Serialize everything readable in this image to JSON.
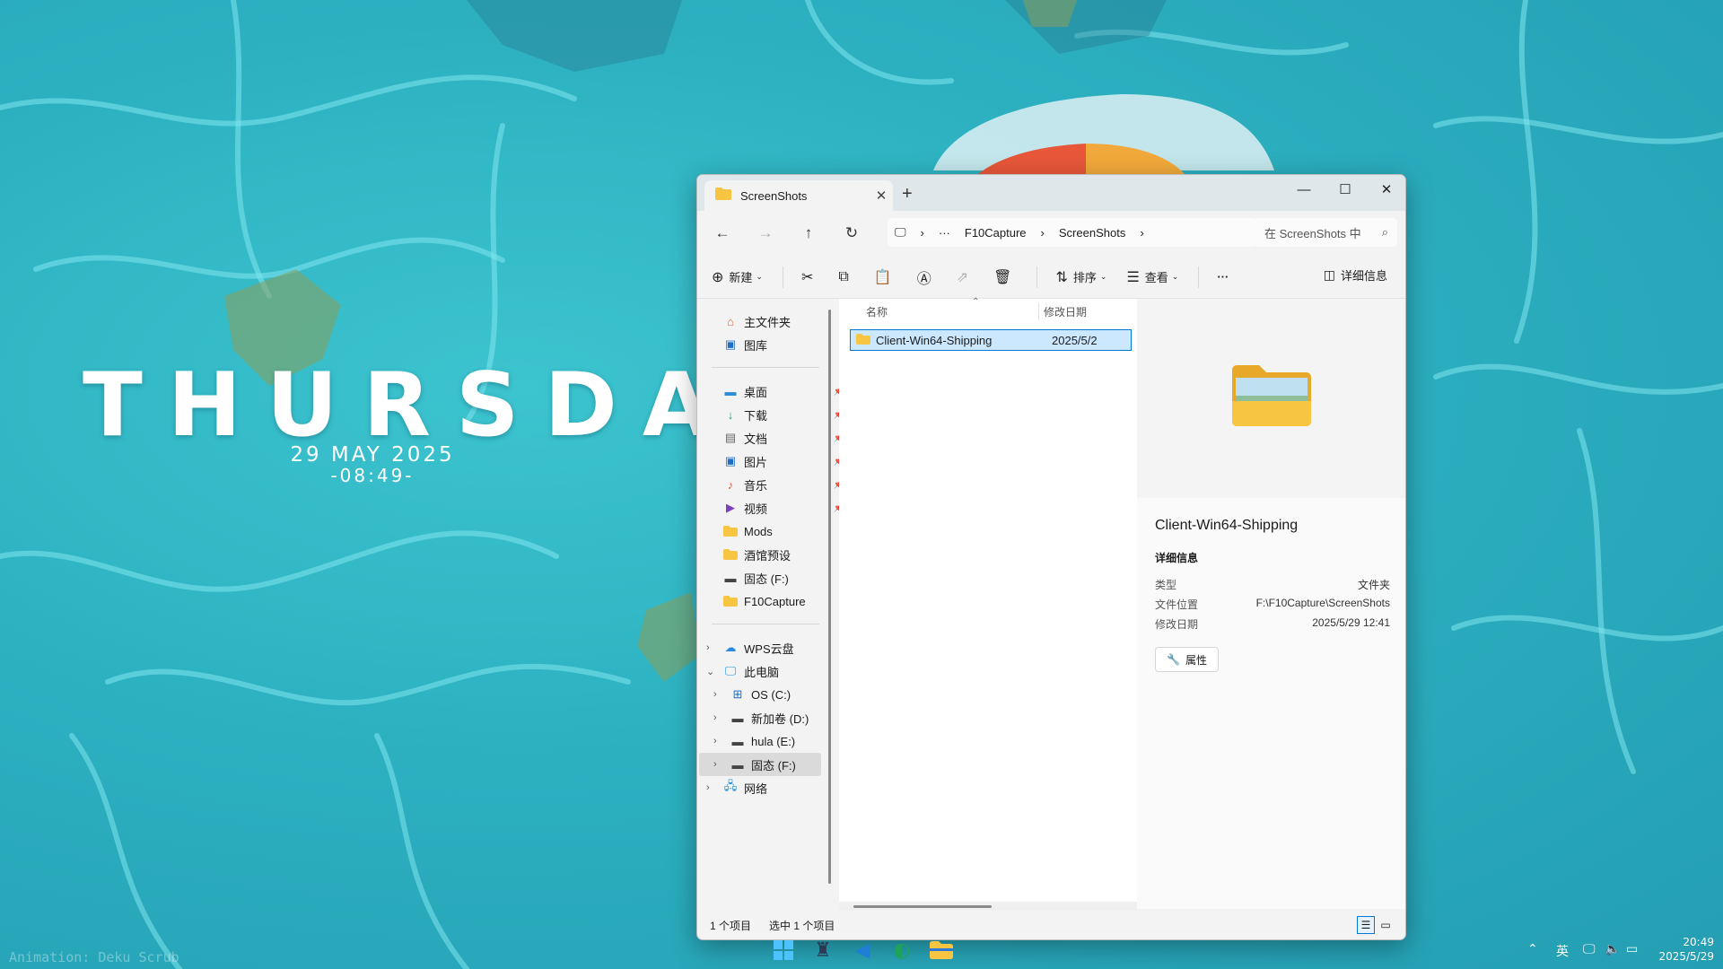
{
  "desktop": {
    "day": "THURSDAY",
    "date": "29 MAY 2025",
    "time": "-08:49-",
    "credit": "Animation: Deku Scrub"
  },
  "window": {
    "tab_title": "ScreenShots",
    "address": [
      "F10Capture",
      "ScreenShots"
    ],
    "address_ellipsis": "···",
    "search_placeholder": "在 ScreenShots 中",
    "commands": {
      "new": "新建",
      "sort": "排序",
      "view": "查看",
      "more": "···",
      "details": "详细信息"
    },
    "sidebar": {
      "quick": [
        {
          "label": "主文件夹",
          "icon": "home-icon"
        },
        {
          "label": "图库",
          "icon": "gallery-icon"
        }
      ],
      "pinned": [
        {
          "label": "桌面",
          "icon": "desktop-icon"
        },
        {
          "label": "下载",
          "icon": "download-icon"
        },
        {
          "label": "文档",
          "icon": "document-icon"
        },
        {
          "label": "图片",
          "icon": "pictures-icon"
        },
        {
          "label": "音乐",
          "icon": "music-icon"
        },
        {
          "label": "视频",
          "icon": "video-icon"
        },
        {
          "label": "Mods",
          "icon": "folder-icon"
        },
        {
          "label": "酒馆预设",
          "icon": "folder-icon"
        },
        {
          "label": "固态 (F:)",
          "icon": "drive-icon"
        },
        {
          "label": "F10Capture",
          "icon": "folder-icon"
        }
      ],
      "tree": [
        {
          "label": "WPS云盘",
          "icon": "cloud-icon"
        },
        {
          "label": "此电脑",
          "icon": "pc-icon"
        },
        {
          "label": "OS (C:)",
          "icon": "windows-drive-icon"
        },
        {
          "label": "新加卷 (D:)",
          "icon": "drive-icon"
        },
        {
          "label": "hula (E:)",
          "icon": "drive-icon"
        },
        {
          "label": "固态 (F:)",
          "icon": "drive-icon"
        },
        {
          "label": "网络",
          "icon": "network-icon"
        }
      ]
    },
    "columns": {
      "name": "名称",
      "modified": "修改日期"
    },
    "files": [
      {
        "name": "Client-Win64-Shipping",
        "modified": "2025/5/2"
      }
    ],
    "preview": {
      "name": "Client-Win64-Shipping",
      "heading": "详细信息",
      "type_label": "类型",
      "type_value": "文件夹",
      "location_label": "文件位置",
      "location_value": "F:\\F10Capture\\ScreenShots",
      "modified_label": "修改日期",
      "modified_value": "2025/5/29 12:41",
      "properties": "属性"
    },
    "status": {
      "count": "1 个项目",
      "selected": "选中 1 个项目"
    }
  },
  "taskbar": {
    "ime": "英",
    "time": "20:49",
    "date": "2025/5/29"
  },
  "colors": {
    "accent": "#0078d4",
    "selection": "#cce8ff",
    "folder": "#f8c543"
  }
}
